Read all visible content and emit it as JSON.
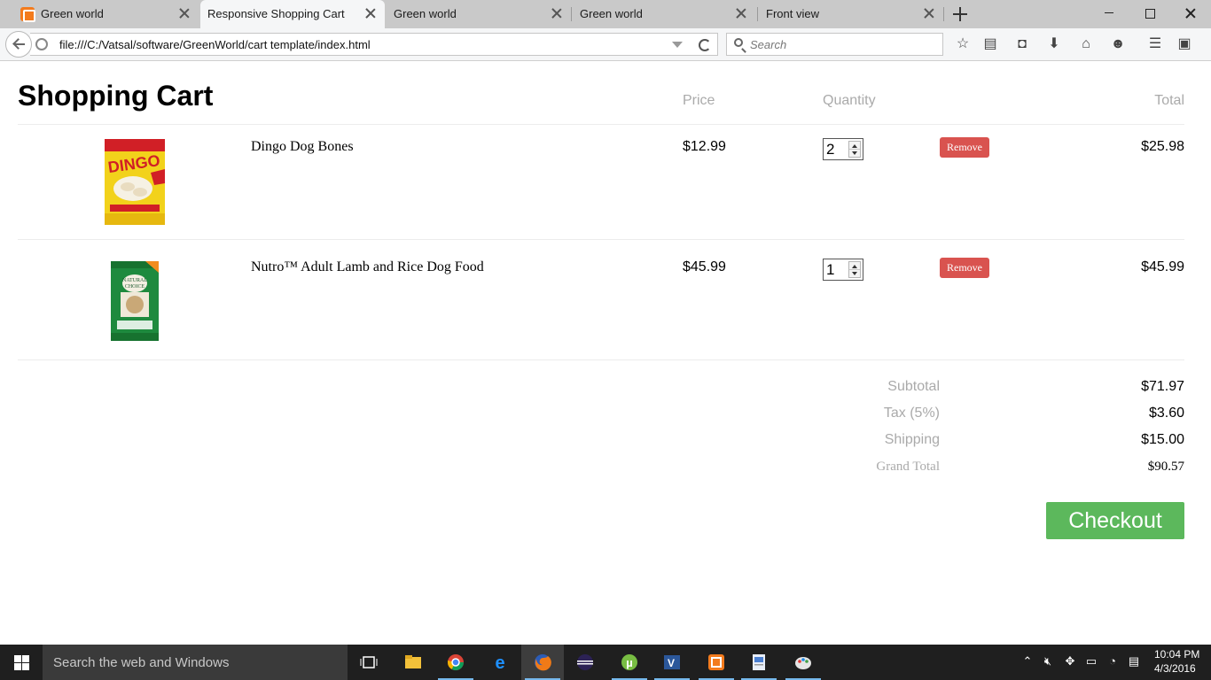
{
  "browser": {
    "tabs": [
      {
        "title": "Green world"
      },
      {
        "title": "Responsive Shopping Cart"
      },
      {
        "title": "Green world"
      },
      {
        "title": "Green world"
      },
      {
        "title": "Front view"
      }
    ],
    "url": "file:///C:/Vatsal/software/GreenWorld/cart template/index.html",
    "search_placeholder": "Search"
  },
  "cart": {
    "title": "Shopping Cart",
    "headers": {
      "price": "Price",
      "quantity": "Quantity",
      "total": "Total"
    },
    "items": [
      {
        "title": "Dingo Dog Bones",
        "price": "$12.99",
        "quantity": "2",
        "remove_label": "Remove",
        "total": "$25.98"
      },
      {
        "title": "Nutro™ Adult Lamb and Rice Dog Food",
        "price": "$45.99",
        "quantity": "1",
        "remove_label": "Remove",
        "total": "$45.99"
      }
    ],
    "totals": {
      "subtotal_label": "Subtotal",
      "subtotal": "$71.97",
      "tax_label": "Tax (5%)",
      "tax": "$3.60",
      "shipping_label": "Shipping",
      "shipping": "$15.00",
      "grand_total_label": "Grand Total",
      "grand_total": "$90.57"
    },
    "checkout_label": "Checkout"
  },
  "taskbar": {
    "search_placeholder": "Search the web and Windows",
    "time": "10:04 PM",
    "date": "4/3/2016"
  },
  "colors": {
    "remove": "#d9534f",
    "checkout": "#5cb85c",
    "taskbar": "#1f1f1f"
  }
}
